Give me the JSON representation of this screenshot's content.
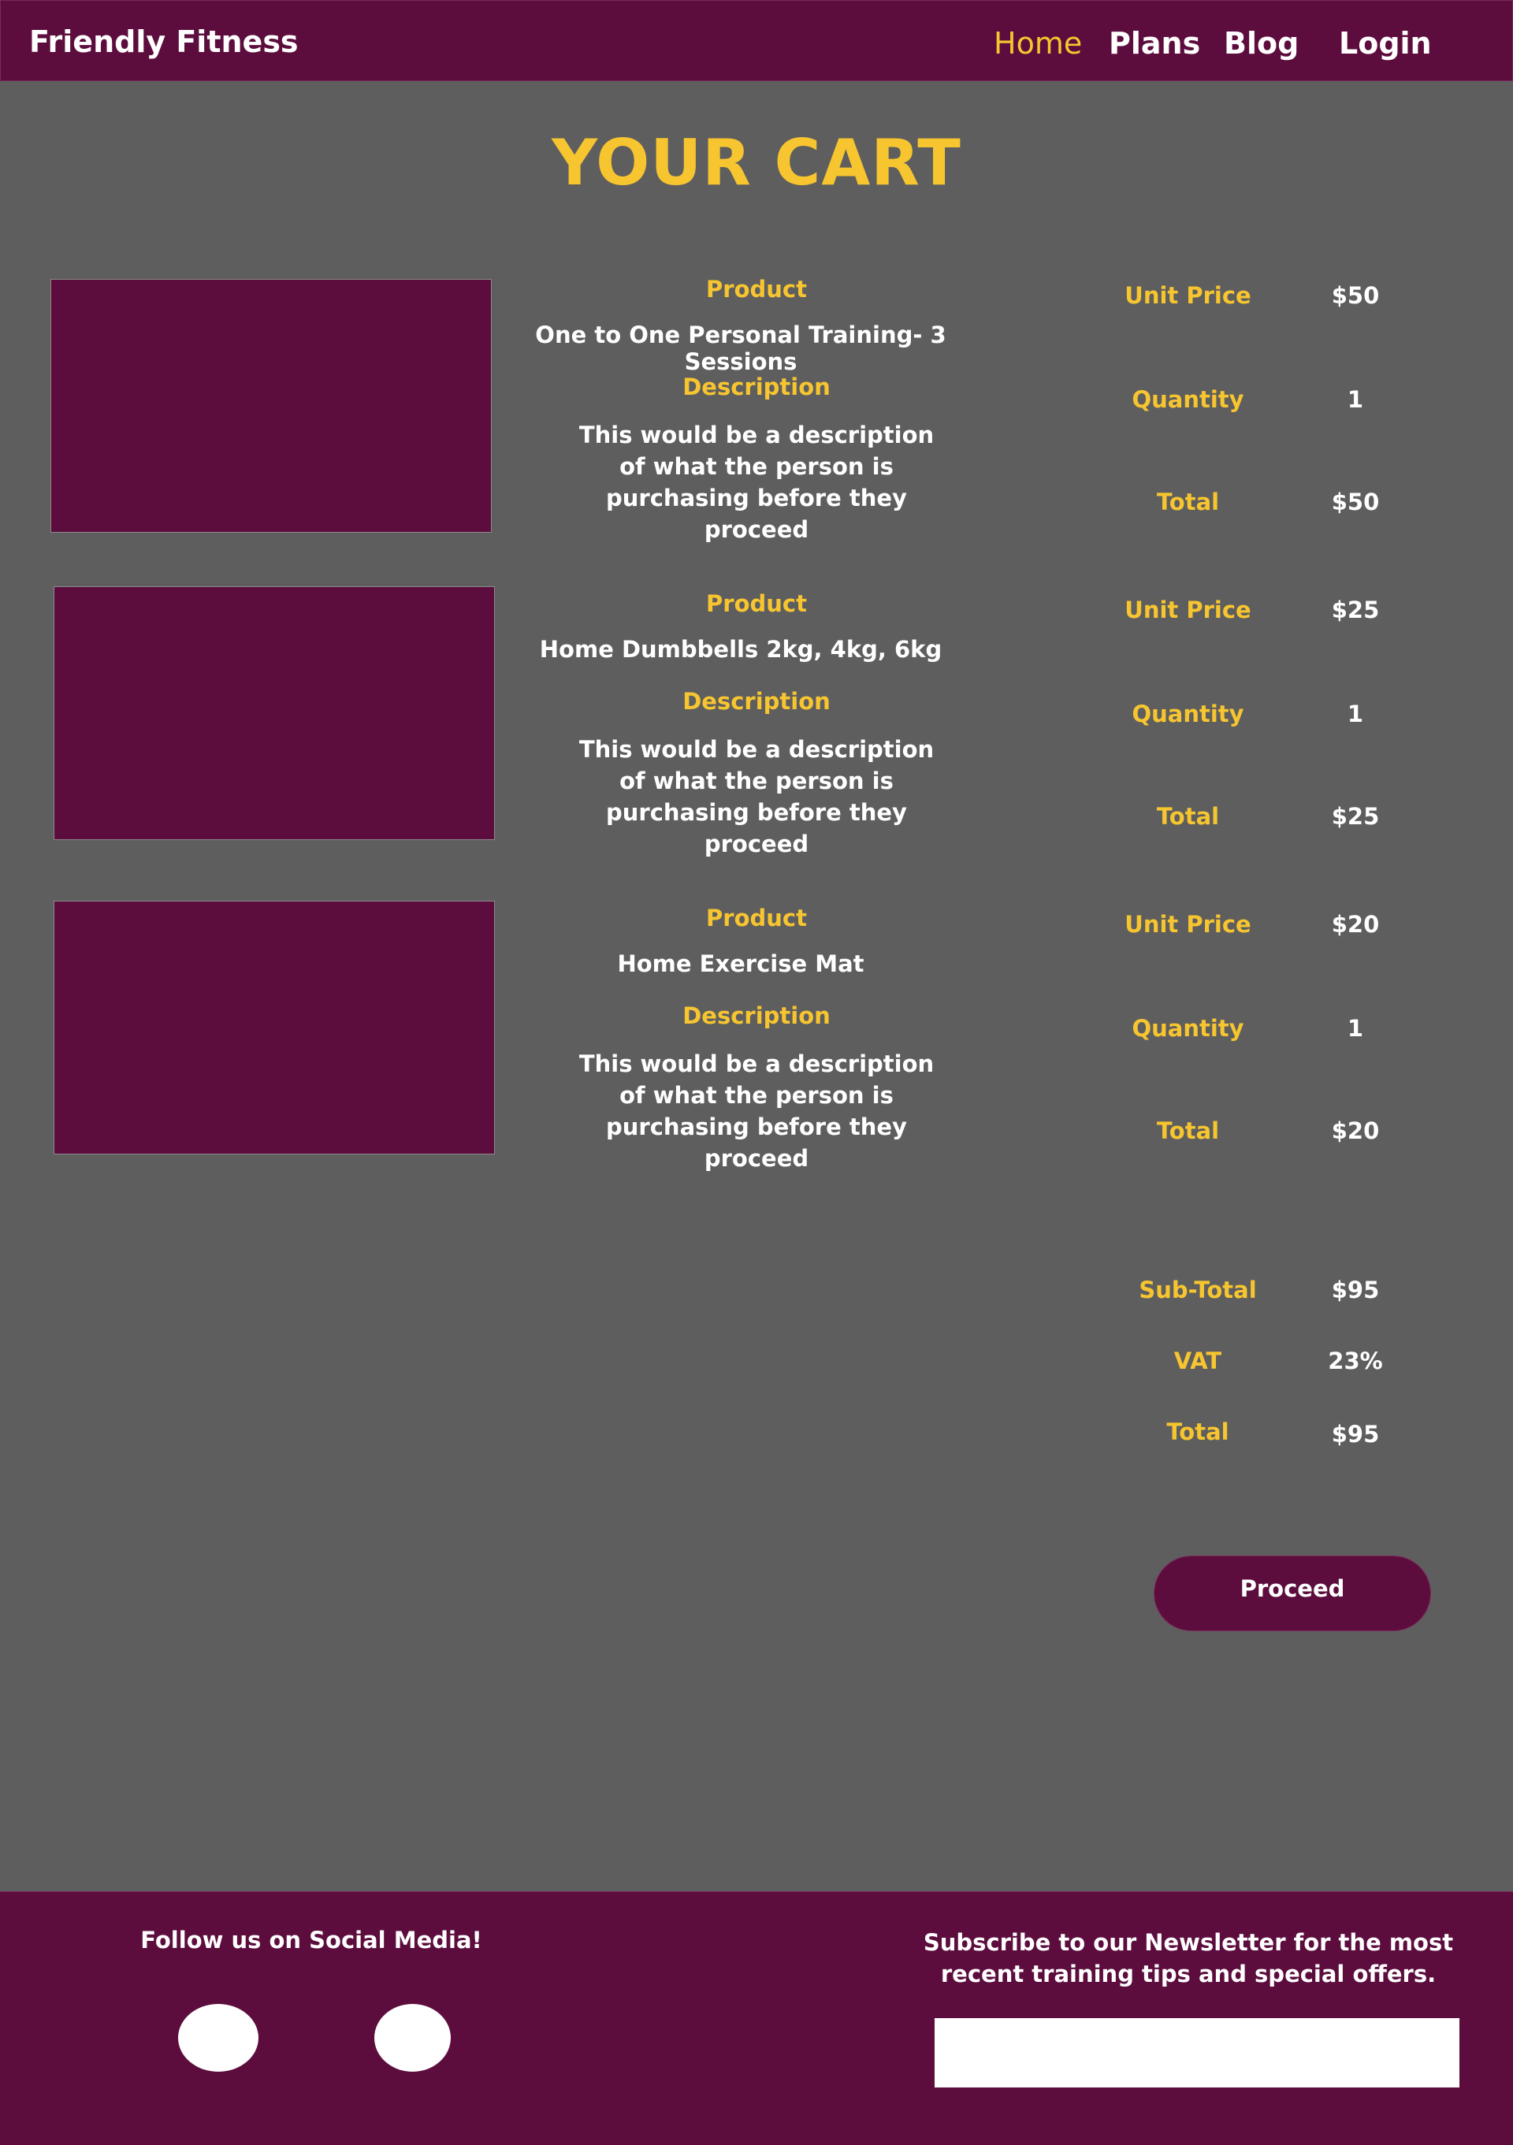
{
  "header": {
    "brand": "Friendly Fitness",
    "nav": [
      {
        "label": "Home",
        "active": true
      },
      {
        "label": "Plans",
        "active": false
      },
      {
        "label": "Blog",
        "active": false
      },
      {
        "label": "Login",
        "active": false
      }
    ]
  },
  "page_title": "YOUR CART",
  "labels": {
    "product": "Product",
    "description": "Description",
    "unit_price": "Unit Price",
    "quantity": "Quantity",
    "total": "Total"
  },
  "cart_items": [
    {
      "product": "One to One Personal Training- 3 Sessions",
      "description": "This would be a description of what the person is purchasing before they proceed",
      "unit_price": "$50",
      "quantity": "1",
      "total": "$50"
    },
    {
      "product": "Home Dumbbells 2kg, 4kg, 6kg",
      "description": "This would be a description of what the person is purchasing before they proceed",
      "unit_price": "$25",
      "quantity": "1",
      "total": "$25"
    },
    {
      "product": "Home Exercise Mat",
      "description": "This would be a description of what the person is purchasing before they proceed",
      "unit_price": "$20",
      "quantity": "1",
      "total": "$20"
    }
  ],
  "summary": {
    "subtotal_label": "Sub-Total",
    "subtotal": "$95",
    "vat_label": "VAT",
    "vat": "23%",
    "total_label": "Total",
    "total": "$95"
  },
  "proceed_label": "Proceed",
  "footer": {
    "social_heading": "Follow us on Social Media!",
    "newsletter_heading": "Subscribe to our Newsletter for the most recent training tips and special offers.",
    "newsletter_placeholder": ""
  },
  "colors": {
    "brand": "#5c0d3d",
    "accent": "#f7c530",
    "background": "#5e5e5e"
  }
}
